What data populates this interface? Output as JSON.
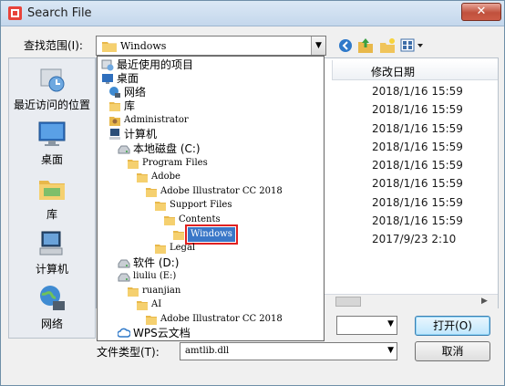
{
  "window": {
    "title": "Search File",
    "close_symbol": "✕"
  },
  "lookin": {
    "label": "查找范围(I):",
    "value": "Windows"
  },
  "places": [
    {
      "label": "最近访问的位置",
      "icon": "recent-places-icon"
    },
    {
      "label": "桌面",
      "icon": "desktop-icon"
    },
    {
      "label": "库",
      "icon": "libraries-icon"
    },
    {
      "label": "计算机",
      "icon": "computer-icon"
    },
    {
      "label": "网络",
      "icon": "network-icon"
    }
  ],
  "file_list": {
    "column_header": "修改日期",
    "dates": [
      "2018/1/16 15:59",
      "2018/1/16 15:59",
      "2018/1/16 15:59",
      "2018/1/16 15:59",
      "2018/1/16 15:59",
      "2018/1/16 15:59",
      "2018/1/16 15:59",
      "2018/1/16 15:59",
      "2017/9/23 2:10"
    ]
  },
  "dropdown": {
    "items": [
      {
        "label": "最近使用的项目",
        "icon": "recent-items-icon"
      },
      {
        "label": "桌面",
        "icon": "desktop-icon"
      },
      {
        "label": "网络",
        "icon": "network-icon"
      },
      {
        "label": "库",
        "icon": "libraries-icon"
      },
      {
        "label": "Administrator",
        "icon": "user-folder-icon"
      },
      {
        "label": "计算机",
        "icon": "computer-icon"
      },
      {
        "label": "本地磁盘 (C:)",
        "icon": "drive-icon"
      },
      {
        "label": "Program Files",
        "icon": "folder-icon"
      },
      {
        "label": "Adobe",
        "icon": "folder-icon"
      },
      {
        "label": "Adobe Illustrator CC 2018",
        "icon": "folder-icon"
      },
      {
        "label": "Support Files",
        "icon": "folder-icon"
      },
      {
        "label": "Contents",
        "icon": "folder-icon"
      },
      {
        "label": "Windows",
        "icon": "folder-icon",
        "selected": true
      },
      {
        "label": "Legal",
        "icon": "folder-icon"
      },
      {
        "label": "软件 (D:)",
        "icon": "drive-icon"
      },
      {
        "label": "liuliu (E:)",
        "icon": "drive-icon"
      },
      {
        "label": "ruanjian",
        "icon": "folder-icon"
      },
      {
        "label": "AI",
        "icon": "folder-icon"
      },
      {
        "label": "Adobe Illustrator CC 2018",
        "icon": "folder-icon"
      },
      {
        "label": "WPS云文档",
        "icon": "cloud-icon"
      }
    ]
  },
  "filetype": {
    "label": "文件类型(T):",
    "value": "amtlib.dll"
  },
  "buttons": {
    "open": "打开(O)",
    "cancel": "取消"
  },
  "colors": {
    "selection": "#3a77c8",
    "highlight_box": "#e02020"
  }
}
